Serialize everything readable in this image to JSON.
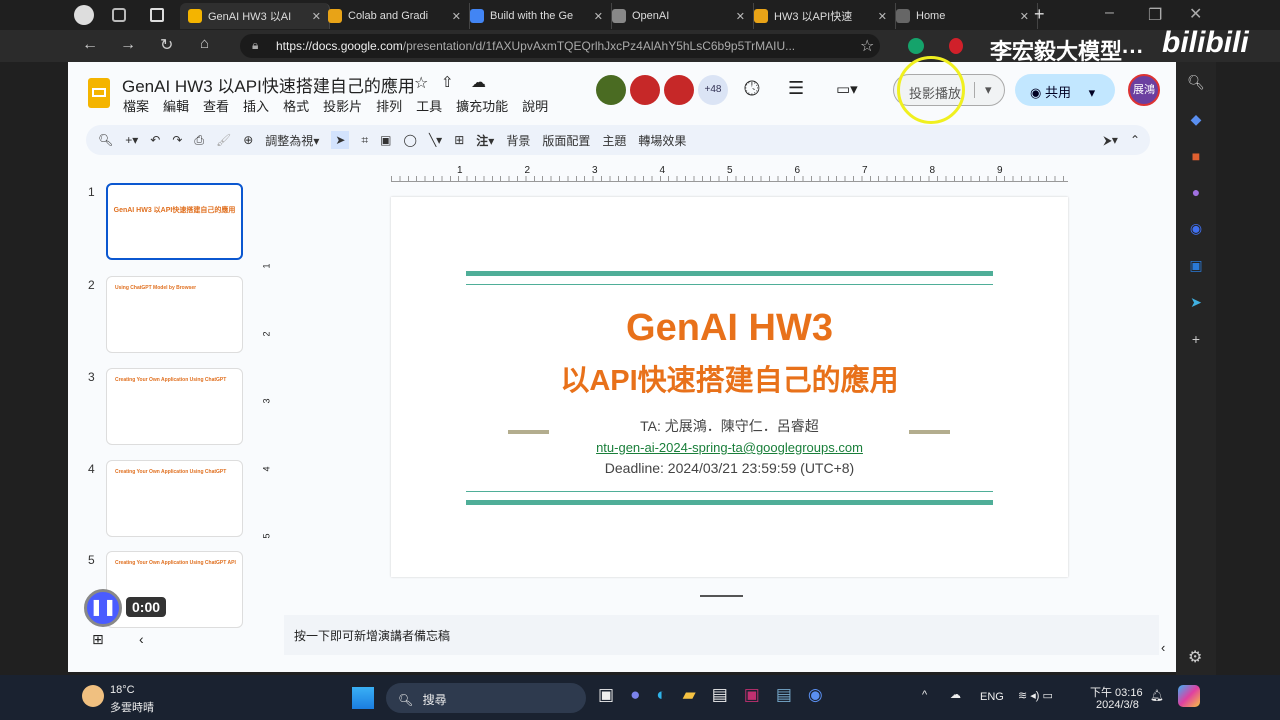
{
  "browser": {
    "tabs": [
      {
        "label": "GenAI HW3 以AI",
        "color": "#f4b400",
        "active": true
      },
      {
        "label": "Colab and Gradi",
        "color": "#e8a317"
      },
      {
        "label": "Build with the Ge",
        "color": "#4285f4"
      },
      {
        "label": "OpenAI",
        "color": "#888888"
      },
      {
        "label": "HW3 以API快速",
        "color": "#e8a317"
      },
      {
        "label": "Home",
        "color": "#666666"
      }
    ],
    "url_host": "https://docs.google.com",
    "url_path": "/presentation/d/1fAXUpvAxmTQEQrlhJxcPz4AlAhY5hLsC6b9p5TrMAIU...",
    "watermark": "李宏毅大模型···",
    "watermark_logo": "bilibili"
  },
  "doc": {
    "title": "GenAI HW3 以API快速搭建自己的應用",
    "menu": [
      "檔案",
      "編輯",
      "查看",
      "插入",
      "格式",
      "投影片",
      "排列",
      "工具",
      "擴充功能",
      "說明"
    ],
    "collaborators_more": "+48",
    "slideshow_label": "投影播放",
    "share_label": "共用",
    "avatar_label": "展鴻"
  },
  "toolbar": {
    "zoom_label": "調整為視",
    "note_label": "注",
    "background": "背景",
    "layout": "版面配置",
    "theme": "主題",
    "transition": "轉場效果"
  },
  "ruler": {
    "h": [
      "1",
      "2",
      "3",
      "4",
      "5",
      "6",
      "7",
      "8",
      "9"
    ],
    "v": [
      "1",
      "2",
      "3",
      "4",
      "5"
    ]
  },
  "filmstrip": [
    {
      "num": "1",
      "title": "GenAI HW3 以API快速搭建自己的應用"
    },
    {
      "num": "2",
      "title": "Using ChatGPT Model by Browser"
    },
    {
      "num": "3",
      "title": "Creating Your Own Application Using ChatGPT"
    },
    {
      "num": "4",
      "title": "Creating Your Own Application Using ChatGPT"
    },
    {
      "num": "5",
      "title": "Creating Your Own Application Using ChatGPT API"
    }
  ],
  "slide": {
    "title": "GenAI HW3",
    "subtitle": "以API快速搭建自己的應用",
    "ta": "TA: 尤展鴻．陳守仁．呂睿超",
    "email": "ntu-gen-ai-2024-spring-ta@googlegroups.com",
    "deadline": "Deadline: 2024/03/21 23:59:59 (UTC+8)",
    "accent": "#e8711a",
    "line_color": "#4fae98"
  },
  "notes_placeholder": "按一下即可新增演講者備忘稿",
  "video": {
    "time": "0:00"
  },
  "taskbar": {
    "temp": "18°C",
    "weather": "多雲時晴",
    "search": "搜尋",
    "lang": "ENG",
    "time": "下午 03:16",
    "date": "2024/3/8"
  }
}
